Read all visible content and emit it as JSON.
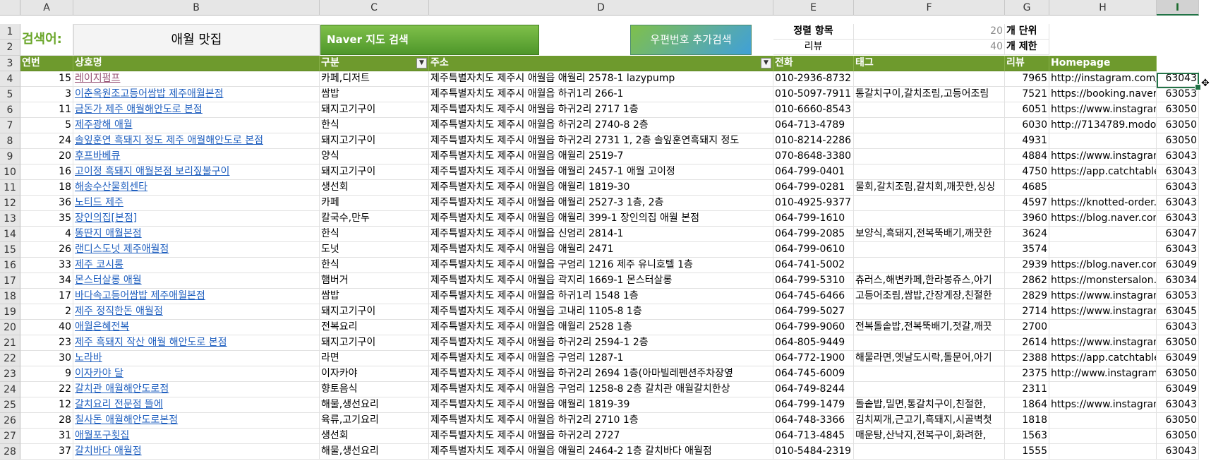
{
  "columns": [
    "A",
    "B",
    "C",
    "D",
    "E",
    "F",
    "G",
    "H",
    "I"
  ],
  "selected_column": "I",
  "search": {
    "label": "검색어:",
    "value": "애월 맛집",
    "naver_button": "Naver 지도 검색",
    "postal_button": "우편번호 추가검색",
    "sort_label": "정렬 항목",
    "sort_value": "20",
    "sort_unit": "개 단위",
    "review_label": "리뷰",
    "review_value": "40",
    "review_unit": "개 제한"
  },
  "headers": [
    "연번",
    "상호명",
    "구분",
    "주소",
    "전화",
    "태그",
    "리뷰",
    "Homepage"
  ],
  "rows": [
    {
      "n": "4",
      "no": "15",
      "name": "레이지펌프",
      "visited": true,
      "cat": "카페,디저트",
      "addr": "제주특별자치도 제주시 애월읍 애월리 2578-1 lazypump",
      "tel": "010-2936-8732",
      "tag": "",
      "rev": "7965",
      "home": "http://instagram.com/",
      "zip": "63043"
    },
    {
      "n": "5",
      "no": "3",
      "name": "이춘옥원조고등어쌈밥 제주애월본점",
      "cat": "쌈밥",
      "addr": "제주특별자치도 제주시 애월읍 하귀1리 266-1",
      "tel": "010-5097-7911",
      "tag": "통갈치구이,갈치조림,고등어조림",
      "rev": "7521",
      "home": "https://booking.naver.",
      "zip": "63053"
    },
    {
      "n": "6",
      "no": "11",
      "name": "금돈가 제주 애월해안도로 본점",
      "cat": "돼지고기구이",
      "addr": "제주특별자치도 제주시 애월읍 하귀2리 2717 1층",
      "tel": "010-6660-8543",
      "tag": "",
      "rev": "6051",
      "home": "https://www.instagram",
      "zip": "63050"
    },
    {
      "n": "7",
      "no": "5",
      "name": "제주광해 애월",
      "cat": "한식",
      "addr": "제주특별자치도 제주시 애월읍 하귀2리 2740-8 2층",
      "tel": "064-713-4789",
      "tag": "",
      "rev": "6030",
      "home": "http://7134789.modoo",
      "zip": "63050"
    },
    {
      "n": "8",
      "no": "24",
      "name": "솔잎훈연 흑돼지 정도 제주 애월해안도로 본점",
      "cat": "돼지고기구이",
      "addr": "제주특별자치도 제주시 애월읍 하귀2리 2731 1, 2층 솔잎훈연흑돼지 정도",
      "tel": "010-8214-2286",
      "tag": "",
      "rev": "4931",
      "home": "",
      "zip": "63050"
    },
    {
      "n": "9",
      "no": "20",
      "name": "후프바베큐",
      "cat": "양식",
      "addr": "제주특별자치도 제주시 애월읍 애월리 2519-7",
      "tel": "070-8648-3380",
      "tag": "",
      "rev": "4884",
      "home": "https://www.instagram",
      "zip": "63043"
    },
    {
      "n": "10",
      "no": "16",
      "name": "고이정 흑돼지 애월본점 보리짚불구이",
      "cat": "돼지고기구이",
      "addr": "제주특별자치도 제주시 애월읍 애월리 2457-1 애월 고이정",
      "tel": "064-799-0401",
      "tag": "",
      "rev": "4750",
      "home": "https://app.catchtable",
      "zip": "63043"
    },
    {
      "n": "11",
      "no": "18",
      "name": "해송수산물회센타",
      "cat": "생선회",
      "addr": "제주특별자치도 제주시 애월읍 애월리 1819-30",
      "tel": "064-799-0281",
      "tag": "물회,갈치조림,갈치회,깨끗한,싱싱",
      "rev": "4685",
      "home": "",
      "zip": "63043"
    },
    {
      "n": "12",
      "no": "36",
      "name": "노티드 제주",
      "cat": "카페",
      "addr": "제주특별자치도 제주시 애월읍 애월리 2527-3 1층, 2층",
      "tel": "010-4925-9377",
      "tag": "",
      "rev": "4597",
      "home": "https://knotted-order.c",
      "zip": "63043"
    },
    {
      "n": "13",
      "no": "35",
      "name": "장인의집[본점]",
      "cat": "칼국수,만두",
      "addr": "제주특별자치도 제주시 애월읍 애월리 399-1 장인의집 애월 본점",
      "tel": "064-799-1610",
      "tag": "",
      "rev": "3960",
      "home": "https://blog.naver.com",
      "zip": "63043"
    },
    {
      "n": "14",
      "no": "4",
      "name": "똥딴지 애월본점",
      "cat": "한식",
      "addr": "제주특별자치도 제주시 애월읍 신엄리 2814-1",
      "tel": "064-799-2085",
      "tag": "보양식,흑돼지,전복뚝배기,깨끗한",
      "rev": "3624",
      "home": "",
      "zip": "63047"
    },
    {
      "n": "15",
      "no": "26",
      "name": "랜디스도넛 제주애월점",
      "cat": "도넛",
      "addr": "제주특별자치도 제주시 애월읍 애월리 2471",
      "tel": "064-799-0610",
      "tag": "",
      "rev": "3574",
      "home": "",
      "zip": "63043"
    },
    {
      "n": "16",
      "no": "33",
      "name": "제주 코시롱",
      "cat": "한식",
      "addr": "제주특별자치도 제주시 애월읍 구엄리 1216 제주 유니호텔 1층",
      "tel": "064-741-5002",
      "tag": "",
      "rev": "2939",
      "home": "https://blog.naver.com",
      "zip": "63049"
    },
    {
      "n": "17",
      "no": "34",
      "name": "몬스터살롱 애월",
      "cat": "햄버거",
      "addr": "제주특별자치도 제주시 애월읍 곽지리 1669-1 몬스터살롱",
      "tel": "064-799-5310",
      "tag": "츄러스,해변카페,한라봉쥬스,아기",
      "rev": "2862",
      "home": "https://monstersalon.n",
      "zip": "63034"
    },
    {
      "n": "18",
      "no": "17",
      "name": "바다속고등어쌈밥 제주애월본점",
      "cat": "쌈밥",
      "addr": "제주특별자치도 제주시 애월읍 하귀1리 1548 1층",
      "tel": "064-745-6466",
      "tag": "고등어조림,쌈밥,간장게장,친절한",
      "rev": "2829",
      "home": "https://www.instagram",
      "zip": "63053"
    },
    {
      "n": "19",
      "no": "2",
      "name": "제주 정직한돈 애월점",
      "cat": "돼지고기구이",
      "addr": "제주특별자치도 제주시 애월읍 고내리 1105-8 1층",
      "tel": "064-799-5027",
      "tag": "",
      "rev": "2714",
      "home": "https://www.instagram",
      "zip": "63045"
    },
    {
      "n": "20",
      "no": "40",
      "name": "애월은혜전복",
      "cat": "전복요리",
      "addr": "제주특별자치도 제주시 애월읍 애월리 2528 1층",
      "tel": "064-799-9060",
      "tag": "전복돌솥밥,전복뚝배기,젓갈,깨끗",
      "rev": "2700",
      "home": "",
      "zip": "63043"
    },
    {
      "n": "21",
      "no": "23",
      "name": "제주 흑돼지 작산 애월 해안도로 본점",
      "cat": "돼지고기구이",
      "addr": "제주특별자치도 제주시 애월읍 하귀2리 2594-1 2층",
      "tel": "064-805-9449",
      "tag": "",
      "rev": "2614",
      "home": "https://www.instagram",
      "zip": "63050"
    },
    {
      "n": "22",
      "no": "30",
      "name": "노라바",
      "cat": "라면",
      "addr": "제주특별자치도 제주시 애월읍 구엄리 1287-1",
      "tel": "064-772-1900",
      "tag": "해물라면,옛날도시락,돌문어,아기",
      "rev": "2388",
      "home": "https://app.catchtable",
      "zip": "63049"
    },
    {
      "n": "23",
      "no": "9",
      "name": "이자카야 달",
      "cat": "이자카야",
      "addr": "제주특별자치도 제주시 애월읍 하귀2리 2694 1층(아마빌레펜션주차장옆",
      "tel": "064-745-6009",
      "tag": "",
      "rev": "2375",
      "home": "http://www.instagram.",
      "zip": "63050"
    },
    {
      "n": "24",
      "no": "22",
      "name": "갈치관 애월해안도로점",
      "cat": "향토음식",
      "addr": "제주특별자치도 제주시 애월읍 구엄리 1258-8 2층 갈치관 애월갈치한상",
      "tel": "064-749-8244",
      "tag": "",
      "rev": "2311",
      "home": "",
      "zip": "63049"
    },
    {
      "n": "25",
      "no": "12",
      "name": "갈치요리 전문점 뜰에",
      "cat": "해물,생선요리",
      "addr": "제주특별자치도 제주시 애월읍 애월리 1819-39",
      "tel": "064-799-1479",
      "tag": "돌솥밥,밀면,통갈치구이,친절한,",
      "rev": "1864",
      "home": "https://www.instagram",
      "zip": "63043"
    },
    {
      "n": "26",
      "no": "28",
      "name": "칠사돈 애월해안도로본점",
      "cat": "육류,고기요리",
      "addr": "제주특별자치도 제주시 애월읍 하귀2리 2710 1층",
      "tel": "064-748-3366",
      "tag": "김치찌개,근고기,흑돼지,시골벽첫",
      "rev": "1818",
      "home": "",
      "zip": "63050"
    },
    {
      "n": "27",
      "no": "31",
      "name": "애월포구횟집",
      "cat": "생선회",
      "addr": "제주특별자치도 제주시 애월읍 하귀2리 2727",
      "tel": "064-713-4845",
      "tag": "매운탕,산낙지,전복구이,화려한,",
      "rev": "1563",
      "home": "",
      "zip": "63050"
    },
    {
      "n": "28",
      "no": "37",
      "name": "갈치바다 애월점",
      "cat": "해물,생선요리",
      "addr": "제주특별자치도 제주시 애월읍 애월리 2464-2 1층 갈치바다 애월점",
      "tel": "010-5484-2319",
      "tag": "",
      "rev": "1555",
      "home": "",
      "zip": "63043"
    }
  ],
  "colors": {
    "green_header": "#6e9a2d",
    "link": "#1f5fbf",
    "visited": "#954f72",
    "label_green": "#6aa62a"
  }
}
